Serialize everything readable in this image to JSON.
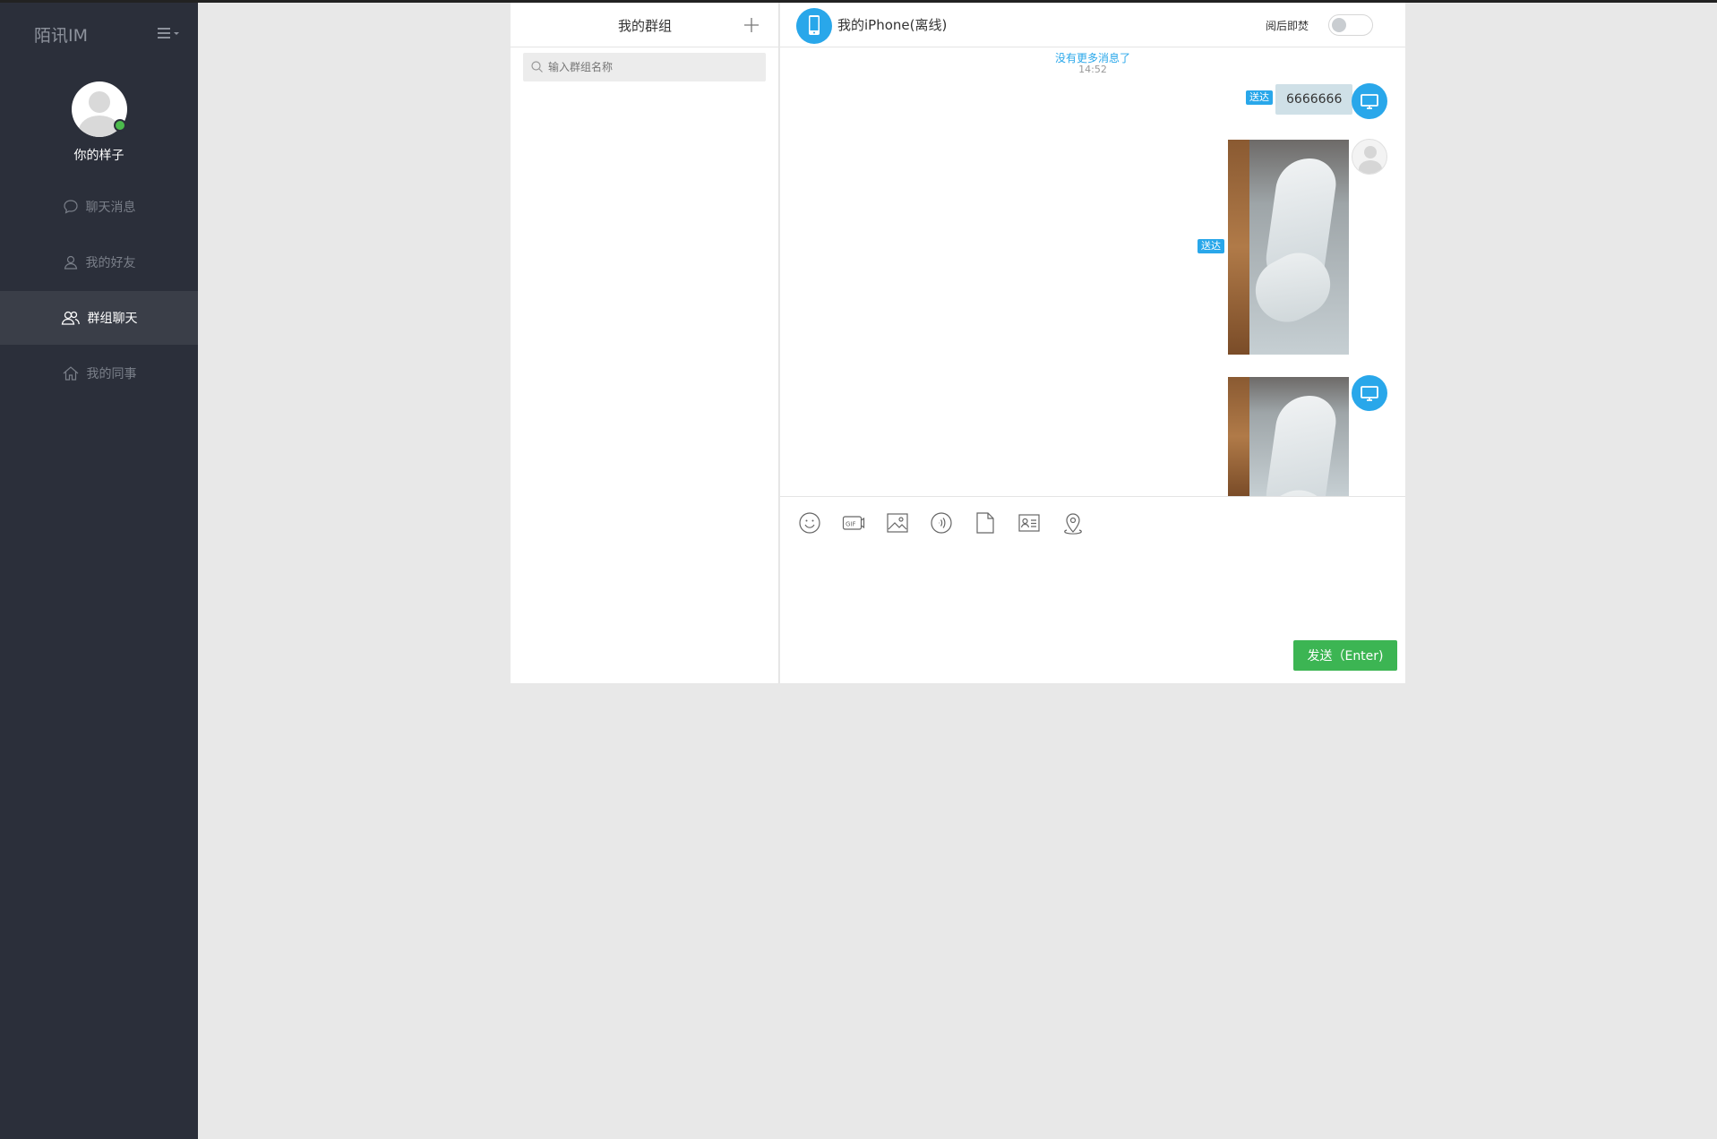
{
  "app": {
    "brand": "陌讯IM"
  },
  "sidebar": {
    "user": {
      "name": "你的样子",
      "status_color": "#4cbb4c"
    },
    "items": [
      {
        "label": "聊天消息",
        "icon": "chat-bubble-icon",
        "active": false
      },
      {
        "label": "我的好友",
        "icon": "user-icon",
        "active": false
      },
      {
        "label": "群组聊天",
        "icon": "group-icon",
        "active": true
      },
      {
        "label": "我的同事",
        "icon": "home-icon",
        "active": false
      }
    ]
  },
  "groups": {
    "title": "我的群组",
    "search_placeholder": "输入群组名称",
    "items": []
  },
  "chat": {
    "contact_name": "我的iPhone(离线)",
    "burn_after_reading_label": "阅后即焚",
    "burn_after_reading_on": false,
    "no_more_messages": "没有更多消息了",
    "time": "14:52",
    "messages": [
      {
        "type": "text",
        "text": "6666666",
        "status": "送达",
        "avatar": "device-icon"
      },
      {
        "type": "image",
        "status": "送达",
        "avatar": "default-user-avatar"
      },
      {
        "type": "image",
        "avatar": "device-icon"
      }
    ],
    "toolbar": [
      "emoji-icon",
      "gif-icon",
      "image-icon",
      "voice-icon",
      "file-icon",
      "contact-card-icon",
      "location-icon"
    ],
    "send_label": "发送（Enter)"
  },
  "colors": {
    "accent": "#29a7ea",
    "send": "#3cb553",
    "sidebar": "#2b2f3a"
  }
}
